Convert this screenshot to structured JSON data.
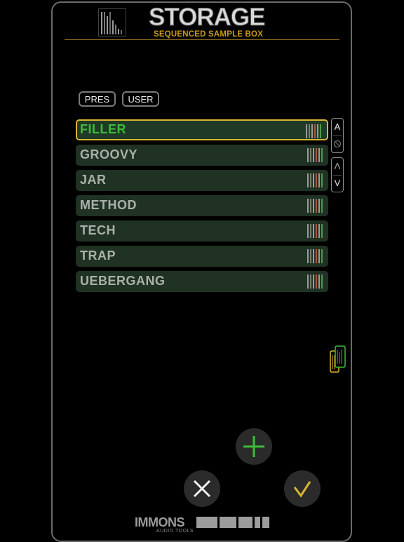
{
  "header": {
    "title": "STORAGE",
    "subtitle": "SEQUENCED SAMPLE BOX"
  },
  "tabs": [
    {
      "label": "PRES"
    },
    {
      "label": "USER"
    }
  ],
  "presets": [
    {
      "label": "FILLER",
      "selected": true
    },
    {
      "label": "GROOVY",
      "selected": false
    },
    {
      "label": "JAR",
      "selected": false
    },
    {
      "label": "METHOD",
      "selected": false
    },
    {
      "label": "TECH",
      "selected": false
    },
    {
      "label": "TRAP",
      "selected": false
    },
    {
      "label": "UEBERGANG",
      "selected": false
    }
  ],
  "side_controls": {
    "sort_label": "A",
    "up_label": "Λ",
    "down_label": "V"
  },
  "footer": {
    "brand": "IMMONS",
    "brand_sub": "AUDIO TOOLS"
  },
  "colors": {
    "accent_gold": "#d9b531",
    "accent_green": "#3dbb3a",
    "row_bg": "#1f3224"
  }
}
